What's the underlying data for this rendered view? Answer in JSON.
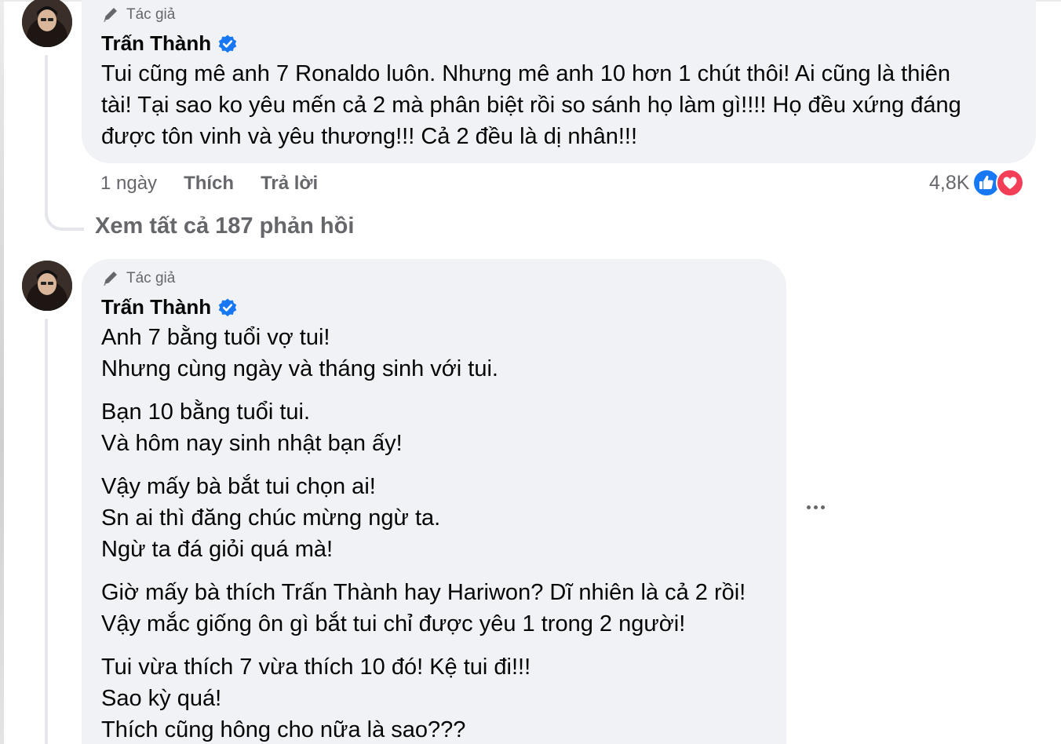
{
  "comments": [
    {
      "badge": "Tác giả",
      "author": "Trấn Thành",
      "text": "Tui cũng mê anh 7 Ronaldo luôn. Nhưng mê anh 10 hơn 1 chút thôi! Ai cũng là thiên\ntài! Tại sao ko yêu mến cả 2 mà phân biệt rồi so sánh họ làm gì!!!! Họ đều xứng đáng\nđược tôn vinh và yêu thương!!! Cả 2 đều là dị nhân!!!",
      "time": "1 ngày",
      "like": "Thích",
      "reply": "Trả lời",
      "reaction_count": "4,8K",
      "view_replies": "Xem tất cả 187 phản hồi"
    },
    {
      "badge": "Tác giả",
      "author": "Trấn Thành",
      "paragraphs": [
        "Anh 7 bằng tuổi vợ tui!\nNhưng cùng ngày và tháng sinh với tui.",
        "Bạn 10 bằng tuổi tui.\nVà hôm nay sinh nhật bạn ấy!",
        "Vậy mấy bà bắt tui chọn ai!\nSn ai thì đăng chúc mừng ngừ ta.\nNgừ ta đá giỏi quá mà!",
        "Giờ mấy bà thích Trấn Thành hay Hariwon? Dĩ nhiên là cả 2 rồi!\nVậy mắc giống ôn gì bắt tui chỉ được yêu 1 trong 2 người!",
        "Tui vừa thích 7 vừa thích 10 đó! Kệ tui đi!!!\nSao kỳ quá!\nThích cũng hông cho nữa là sao???"
      ]
    }
  ],
  "icons": {
    "pencil": "pencil-icon",
    "verified": "verified-badge-icon",
    "like_reaction": "like-reaction-icon",
    "love_reaction": "love-reaction-icon",
    "more": "more-options-icon"
  },
  "colors": {
    "facebook_blue": "#1877f2",
    "love_red": "#f33e58",
    "bubble_bg": "#f0f2f5",
    "secondary_text": "#65676b"
  }
}
